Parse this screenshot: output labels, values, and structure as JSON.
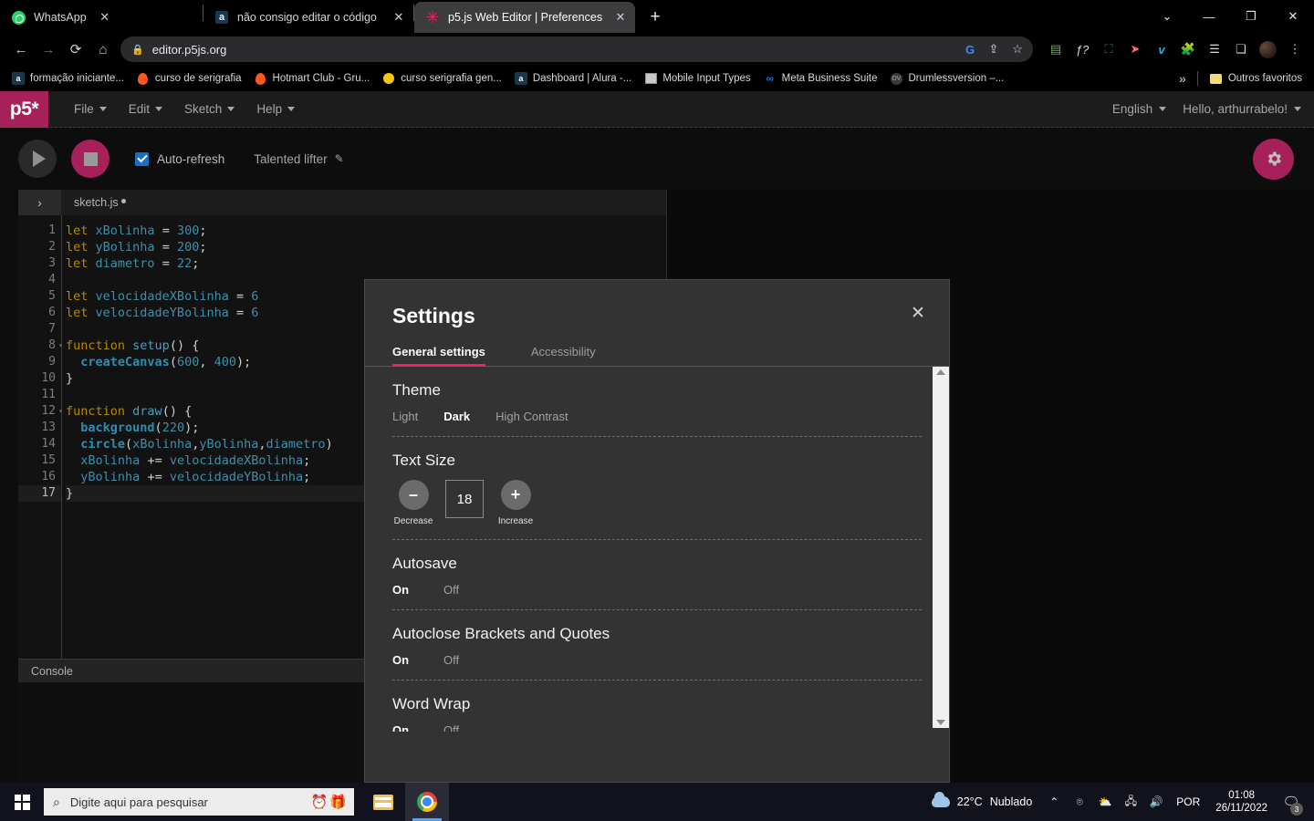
{
  "browser": {
    "tabs": [
      {
        "title": "WhatsApp",
        "favicon": "whatsapp-icon",
        "active": false
      },
      {
        "title": "não consigo editar o código no p",
        "favicon": "alura-icon",
        "active": false
      },
      {
        "title": "p5.js Web Editor | Preferences",
        "favicon": "p5js-icon",
        "active": true
      }
    ],
    "new_tab_label": "+",
    "close_label": "✕",
    "window_controls": {
      "minimize_chrome": "⌄",
      "minimize": "—",
      "maximize": "❐",
      "close": "✕"
    },
    "nav": {
      "back": "←",
      "forward": "→",
      "reload": "⟳",
      "home": "⌂"
    },
    "omnibox": {
      "lock": "🔒",
      "url": "editor.p5js.org",
      "google_lens": "G",
      "share": "⇪",
      "bookmark": "☆"
    },
    "extensions": [
      "reader-icon",
      "fx-icon",
      "capture-icon",
      "speed-icon",
      "vimeo-icon",
      "puzzle-icon",
      "playlist-icon",
      "sidepanel-icon"
    ],
    "menu_label": "⋮",
    "bookmarks": [
      {
        "label": "formação iniciante...",
        "icon": "alura-icon"
      },
      {
        "label": "curso de serigrafia",
        "icon": "flame-icon"
      },
      {
        "label": "Hotmart Club - Gru...",
        "icon": "flame-icon"
      },
      {
        "label": "curso serigrafia gen...",
        "icon": "coin-icon"
      },
      {
        "label": "Dashboard | Alura -...",
        "icon": "alura-icon"
      },
      {
        "label": "Mobile Input Types",
        "icon": "mobile-icon"
      },
      {
        "label": "Meta Business Suite",
        "icon": "meta-icon"
      },
      {
        "label": "Drumlessversion –...",
        "icon": "drum-icon"
      }
    ],
    "bookmarks_overflow": "»",
    "other_bookmarks": {
      "label": "Outros favoritos",
      "icon": "folder-icon"
    }
  },
  "p5": {
    "logo": "p5*",
    "menu": [
      "File",
      "Edit",
      "Sketch",
      "Help"
    ],
    "language": "English",
    "greeting": "Hello, arthurrabelo!",
    "toolbar": {
      "play": "play-button",
      "stop": "stop-button",
      "autorefresh_label": "Auto-refresh",
      "autorefresh_checked": true,
      "sketch_name": "Talented lifter",
      "edit_icon": "✎",
      "settings_icon": "⚙"
    },
    "file_tab": "sketch.js",
    "file_unsaved": true,
    "sidebar_toggle": "›",
    "console_label": "Console",
    "code_lines": [
      {
        "n": 1,
        "fold": false,
        "html": "<span class=\"kw\">let</span> <span class=\"var\">xBolinha</span> <span class=\"pl\">=</span> <span class=\"num\">300</span><span class=\"pl\">;</span>"
      },
      {
        "n": 2,
        "fold": false,
        "html": "<span class=\"kw\">let</span> <span class=\"var\">yBolinha</span> <span class=\"pl\">=</span> <span class=\"num\">200</span><span class=\"pl\">;</span>"
      },
      {
        "n": 3,
        "fold": false,
        "html": "<span class=\"kw\">let</span> <span class=\"var\">diametro</span> <span class=\"pl\">=</span> <span class=\"num\">22</span><span class=\"pl\">;</span>"
      },
      {
        "n": 4,
        "fold": false,
        "html": ""
      },
      {
        "n": 5,
        "fold": false,
        "html": "<span class=\"kw\">let</span> <span class=\"var\">velocidadeXBolinha</span> <span class=\"pl\">=</span> <span class=\"num\">6</span>"
      },
      {
        "n": 6,
        "fold": false,
        "html": "<span class=\"kw\">let</span> <span class=\"var\">velocidadeYBolinha</span> <span class=\"pl\">=</span> <span class=\"num\">6</span>"
      },
      {
        "n": 7,
        "fold": false,
        "html": ""
      },
      {
        "n": 8,
        "fold": true,
        "html": "<span class=\"kw\">function</span> <span class=\"nm\">setup</span><span class=\"pl\">() {</span>"
      },
      {
        "n": 9,
        "fold": false,
        "html": "  <span class=\"fn\">createCanvas</span><span class=\"pl\">(</span><span class=\"num\">600</span><span class=\"pl\">, </span><span class=\"num\">400</span><span class=\"pl\">);</span>"
      },
      {
        "n": 10,
        "fold": false,
        "html": "<span class=\"pl\">}</span>"
      },
      {
        "n": 11,
        "fold": false,
        "html": ""
      },
      {
        "n": 12,
        "fold": true,
        "html": "<span class=\"kw\">function</span> <span class=\"nm\">draw</span><span class=\"pl\">() {</span>"
      },
      {
        "n": 13,
        "fold": false,
        "html": "  <span class=\"fn\">background</span><span class=\"pl\">(</span><span class=\"num\">220</span><span class=\"pl\">);</span>"
      },
      {
        "n": 14,
        "fold": false,
        "html": "  <span class=\"fn\">circle</span><span class=\"pl\">(</span><span class=\"var\">xBolinha</span><span class=\"pl\">,</span><span class=\"var\">yBolinha</span><span class=\"pl\">,</span><span class=\"var\">diametro</span><span class=\"pl\">)</span>"
      },
      {
        "n": 15,
        "fold": false,
        "html": "  <span class=\"var\">xBolinha</span> <span class=\"pl\">+=</span> <span class=\"var\">velocidadeXBolinha</span><span class=\"pl\">;</span>"
      },
      {
        "n": 16,
        "fold": false,
        "html": "  <span class=\"var\">yBolinha</span> <span class=\"pl\">+=</span> <span class=\"var\">velocidadeYBolinha</span><span class=\"pl\">;</span>"
      },
      {
        "n": 17,
        "fold": false,
        "active": true,
        "html": "<span class=\"pl\">}</span>"
      }
    ]
  },
  "settings_modal": {
    "title": "Settings",
    "close_label": "✕",
    "tabs": [
      {
        "label": "General settings",
        "active": true
      },
      {
        "label": "Accessibility",
        "active": false
      }
    ],
    "accent_color": "#ed225d",
    "sections": [
      {
        "heading": "Theme",
        "type": "options",
        "options": [
          {
            "label": "Light",
            "selected": false
          },
          {
            "label": "Dark",
            "selected": true
          },
          {
            "label": "High Contrast",
            "selected": false
          }
        ]
      },
      {
        "heading": "Text Size",
        "type": "stepper",
        "decrease_label": "Decrease",
        "decrease_symbol": "–",
        "increase_label": "Increase",
        "increase_symbol": "+",
        "value": "18"
      },
      {
        "heading": "Autosave",
        "type": "options",
        "options": [
          {
            "label": "On",
            "selected": true
          },
          {
            "label": "Off",
            "selected": false
          }
        ]
      },
      {
        "heading": "Autoclose Brackets and Quotes",
        "type": "options",
        "options": [
          {
            "label": "On",
            "selected": true
          },
          {
            "label": "Off",
            "selected": false
          }
        ]
      },
      {
        "heading": "Word Wrap",
        "type": "options",
        "options": [
          {
            "label": "On",
            "selected": true
          },
          {
            "label": "Off",
            "selected": false
          }
        ]
      }
    ]
  },
  "taskbar": {
    "start_label": "start-button",
    "search_placeholder": "Digite aqui para pesquisar",
    "search_icon": "🔍",
    "emoji_1": "⏰",
    "emoji_2": "🎁",
    "apps": [
      {
        "name": "file-explorer",
        "active": false
      },
      {
        "name": "google-chrome",
        "active": true
      }
    ],
    "weather": {
      "temperature": "22°C",
      "condition": "Nublado"
    },
    "tray_arrow": "⌃",
    "tray_icons": [
      "camera-icon",
      "onedrive-icon",
      "network-icon",
      "volume-icon"
    ],
    "language": "POR",
    "time": "01:08",
    "date": "26/11/2022",
    "notification_count": "3"
  }
}
